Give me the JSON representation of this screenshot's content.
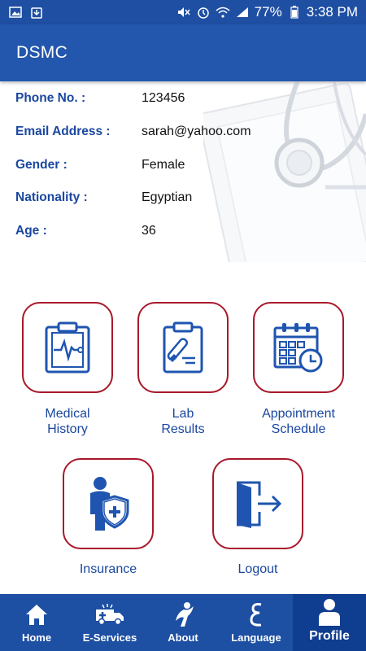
{
  "status_bar": {
    "battery": "77%",
    "time": "3:38 PM"
  },
  "app_bar": {
    "title": "DSMC"
  },
  "profile_info": [
    {
      "label": "Phone No. :",
      "value": "123456"
    },
    {
      "label": "Email Address :",
      "value": "sarah@yahoo.com"
    },
    {
      "label": "Gender :",
      "value": "Female"
    },
    {
      "label": "Nationality :",
      "value": "Egyptian"
    },
    {
      "label": "Age :",
      "value": "36"
    }
  ],
  "tiles": {
    "medical_history": {
      "line1": "Medical",
      "line2": "History",
      "icon": "clipboard-heartbeat-icon"
    },
    "lab_results": {
      "line1": "Lab",
      "line2": "Results",
      "icon": "clipboard-test-tube-icon"
    },
    "appointment_schedule": {
      "line1": "Appointment",
      "line2": "Schedule",
      "icon": "calendar-clock-icon"
    },
    "insurance": {
      "label": "Insurance",
      "icon": "person-shield-icon"
    },
    "logout": {
      "label": "Logout",
      "icon": "door-exit-icon"
    }
  },
  "bottom_nav": [
    {
      "label": "Home",
      "icon": "home-icon"
    },
    {
      "label": "E-Services",
      "icon": "ambulance-icon"
    },
    {
      "label": "About",
      "icon": "logo-figure-icon"
    },
    {
      "label": "Language",
      "icon": "arabic-letter-icon"
    },
    {
      "label": "Profile",
      "icon": "person-icon"
    }
  ],
  "colors": {
    "primary": "#2357ad",
    "accent_border": "#a8182a",
    "label_blue": "#1a47a0",
    "nav_active": "#0f3d8f"
  }
}
